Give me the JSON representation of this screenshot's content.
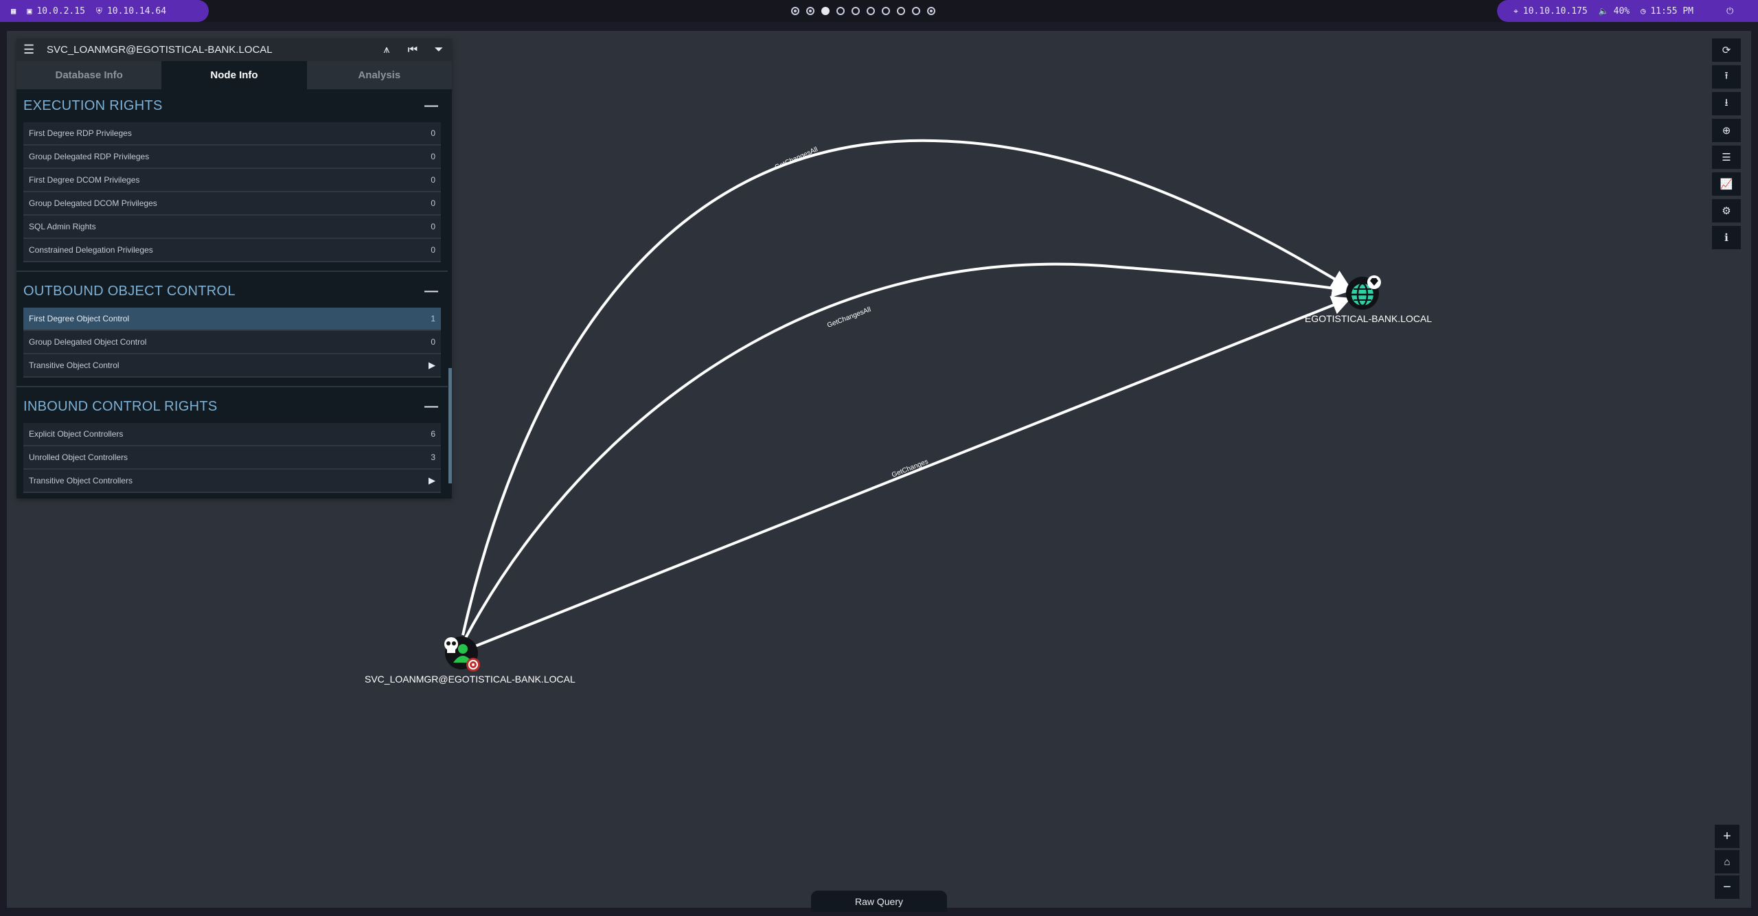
{
  "topbar": {
    "ip_local": "10.0.2.15",
    "ip_vpn": "10.10.14.64",
    "target_ip": "10.10.10.175",
    "volume": "40%",
    "time": "11:55 PM",
    "workspaces": [
      "dot",
      "dot",
      "active",
      "empty",
      "empty",
      "empty",
      "empty",
      "empty",
      "empty",
      "dot"
    ]
  },
  "panel": {
    "node_name": "SVC_LOANMGR@EGOTISTICAL-BANK.LOCAL",
    "tabs": [
      "Database Info",
      "Node Info",
      "Analysis"
    ],
    "active_tab": "Node Info",
    "sections": [
      {
        "title": "EXECUTION RIGHTS",
        "rows": [
          {
            "label": "First Degree RDP Privileges",
            "value": "0"
          },
          {
            "label": "Group Delegated RDP Privileges",
            "value": "0"
          },
          {
            "label": "First Degree DCOM Privileges",
            "value": "0"
          },
          {
            "label": "Group Delegated DCOM Privileges",
            "value": "0"
          },
          {
            "label": "SQL Admin Rights",
            "value": "0"
          },
          {
            "label": "Constrained Delegation Privileges",
            "value": "0"
          }
        ]
      },
      {
        "title": "OUTBOUND OBJECT CONTROL",
        "rows": [
          {
            "label": "First Degree Object Control",
            "value": "1",
            "highlight": true
          },
          {
            "label": "Group Delegated Object Control",
            "value": "0"
          },
          {
            "label": "Transitive Object Control",
            "value": "▶"
          }
        ]
      },
      {
        "title": "INBOUND CONTROL RIGHTS",
        "rows": [
          {
            "label": "Explicit Object Controllers",
            "value": "6"
          },
          {
            "label": "Unrolled Object Controllers",
            "value": "3"
          },
          {
            "label": "Transitive Object Controllers",
            "value": "▶"
          }
        ]
      }
    ]
  },
  "graph": {
    "nodes": {
      "user": "SVC_LOANMGR@EGOTISTICAL-BANK.LOCAL",
      "domain": "EGOTISTICAL-BANK.LOCAL"
    },
    "edges": [
      "GetChangesAll",
      "GetChangesAll",
      "GetChanges"
    ]
  },
  "raw_query_label": "Raw Query"
}
